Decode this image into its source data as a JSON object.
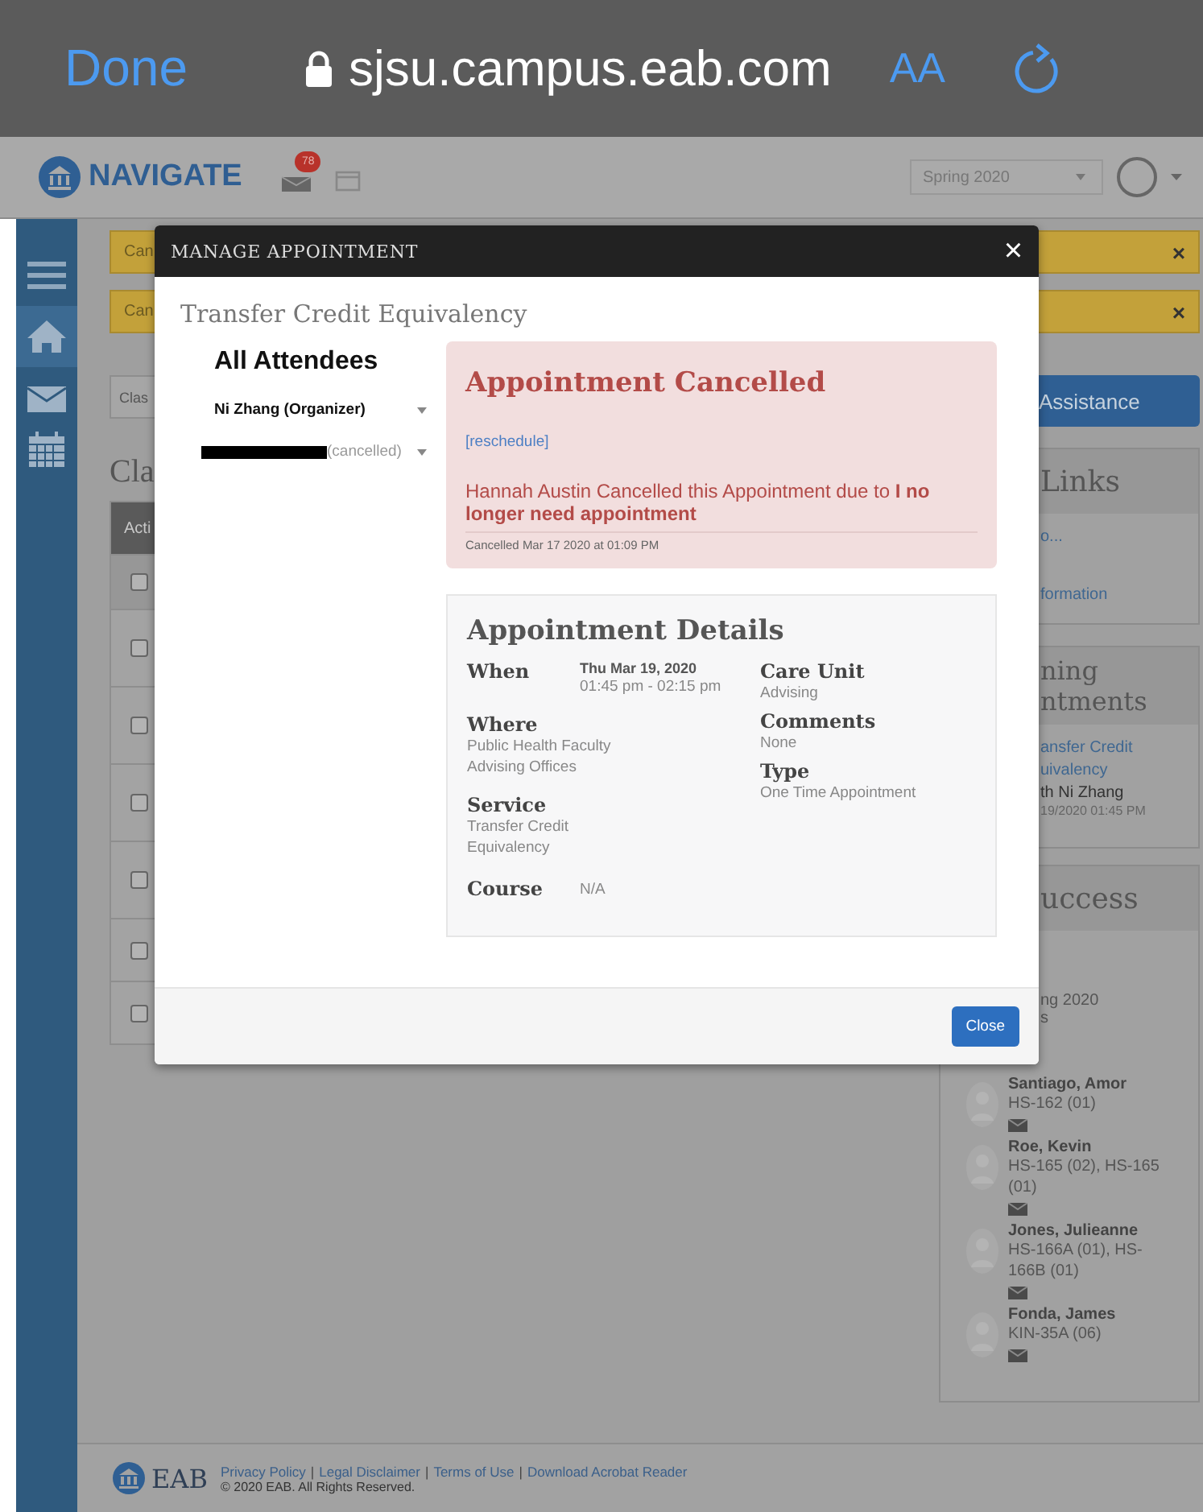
{
  "browser": {
    "done": "Done",
    "url": "sjsu.campus.eab.com",
    "text_size": "AA"
  },
  "app_header": {
    "logo": "NAVIGATE",
    "badge": "78",
    "term": "Spring 2020"
  },
  "banners": [
    {
      "text": "Can",
      "close": "×"
    },
    {
      "text": "Can",
      "close": "×"
    }
  ],
  "content": {
    "filter": "Clas",
    "heading": "Cla",
    "table_header": "Acti",
    "rows": [
      {
        "checked": false
      },
      {
        "checked": false
      },
      {
        "checked": false
      },
      {
        "checked": false
      },
      {
        "checked": false
      },
      {
        "checked": false
      },
      {
        "checked": false
      }
    ]
  },
  "sidebar": {
    "button": "Assistance",
    "links_panel": {
      "title": "Links",
      "links": [
        "o...",
        "formation"
      ]
    },
    "appointments_panel": {
      "title_lines": [
        "ning",
        "ntments"
      ],
      "link_lines": [
        "ansfer Credit",
        "uivalency"
      ],
      "with": "th Ni Zhang",
      "date": "19/2020 01:45 PM"
    },
    "success_panel": {
      "title": "uccess",
      "term": "ng 2020",
      "note": "s",
      "students": [
        {
          "name": "Santiago, Amor",
          "courses": "HS-162 (01)"
        },
        {
          "name": "Roe, Kevin",
          "courses": "HS-165 (02), HS-165 (01)"
        },
        {
          "name": "Jones, Julieanne",
          "courses": "HS-166A (01), HS-166B (01)"
        },
        {
          "name": "Fonda, James",
          "courses": "KIN-35A (06)"
        }
      ]
    }
  },
  "footer": {
    "logo": "EAB",
    "links": [
      "Privacy Policy",
      "Legal Disclaimer",
      "Terms of Use",
      "Download Acrobat Reader"
    ],
    "separator": "|",
    "copyright": "© 2020 EAB. All Rights Reserved."
  },
  "modal": {
    "title": "MANAGE APPOINTMENT",
    "close": "×",
    "subject": "Transfer Credit Equivalency",
    "attendees_heading": "All Attendees",
    "attendees": [
      {
        "kind": "organizer",
        "name": "Ni Zhang (Organizer)"
      },
      {
        "kind": "redacted",
        "name": "(cancelled)"
      }
    ],
    "status": {
      "title": "Appointment Cancelled",
      "link": "[reschedule]",
      "message": "Hannah Austin Cancelled this Appointment due to **I no longer need appointment**",
      "timestamp": "Cancelled Mar 17 2020 at 01:09 PM"
    },
    "details": {
      "title": "Appointment Details",
      "when": {
        "label": "When",
        "date": "Thu Mar 19, 2020",
        "time": "01:45 pm - 02:15 pm"
      },
      "left": [
        {
          "label": "Where",
          "value": "Public Health Faculty Advising Offices"
        },
        {
          "label": "Service",
          "value": "Transfer Credit Equivalency"
        }
      ],
      "course": {
        "label": "Course",
        "value": "N/A"
      },
      "right": [
        {
          "label": "Care Unit",
          "value": "Advising"
        },
        {
          "label": "Comments",
          "value": "None"
        },
        {
          "label": "Type",
          "value": "One Time Appointment"
        }
      ]
    },
    "button": "Close"
  }
}
